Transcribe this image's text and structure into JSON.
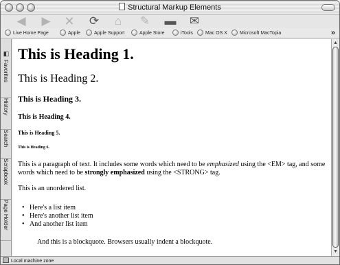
{
  "window": {
    "title": "Structural Markup Elements"
  },
  "toolbar": {
    "buttons": [
      {
        "icon": "back-icon"
      },
      {
        "icon": "forward-icon"
      },
      {
        "icon": "stop-icon"
      },
      {
        "icon": "refresh-icon"
      },
      {
        "icon": "home-icon"
      },
      {
        "icon": "autofill-icon"
      },
      {
        "icon": "print-icon"
      },
      {
        "icon": "mail-icon"
      }
    ]
  },
  "favorites": {
    "items": [
      "Live Home Page",
      "Apple",
      "Apple Support",
      "Apple Store",
      "iTools",
      "Mac OS X",
      "Microsoft MacTopia"
    ],
    "more": "»"
  },
  "sidebar": {
    "tabs": [
      "Favorites",
      "History",
      "Search",
      "Scrapbook",
      "Page Holder"
    ]
  },
  "page": {
    "h1": "This is Heading 1.",
    "h2": "This is Heading 2.",
    "h3": "This is Heading 3.",
    "h4": "This is Heading 4.",
    "h5": "This is Heading 5.",
    "h6": "This is Heading 6.",
    "paragraph": {
      "part1": "This is a paragraph of text. It includes some words which need to be ",
      "em": "emphasized",
      "part2": " using the <EM> tag, and some words which need to be ",
      "strong": "strongly emphasized",
      "part3": " using the <STRONG> tag."
    },
    "list_intro": "This is an unordered list.",
    "list_items": [
      "Here's a list item",
      "Here's another list item",
      "And another list item"
    ],
    "blockquote": "And this is a blockquote. Browsers usually indent a blockquote."
  },
  "status": {
    "zone": "Local machine zone"
  }
}
